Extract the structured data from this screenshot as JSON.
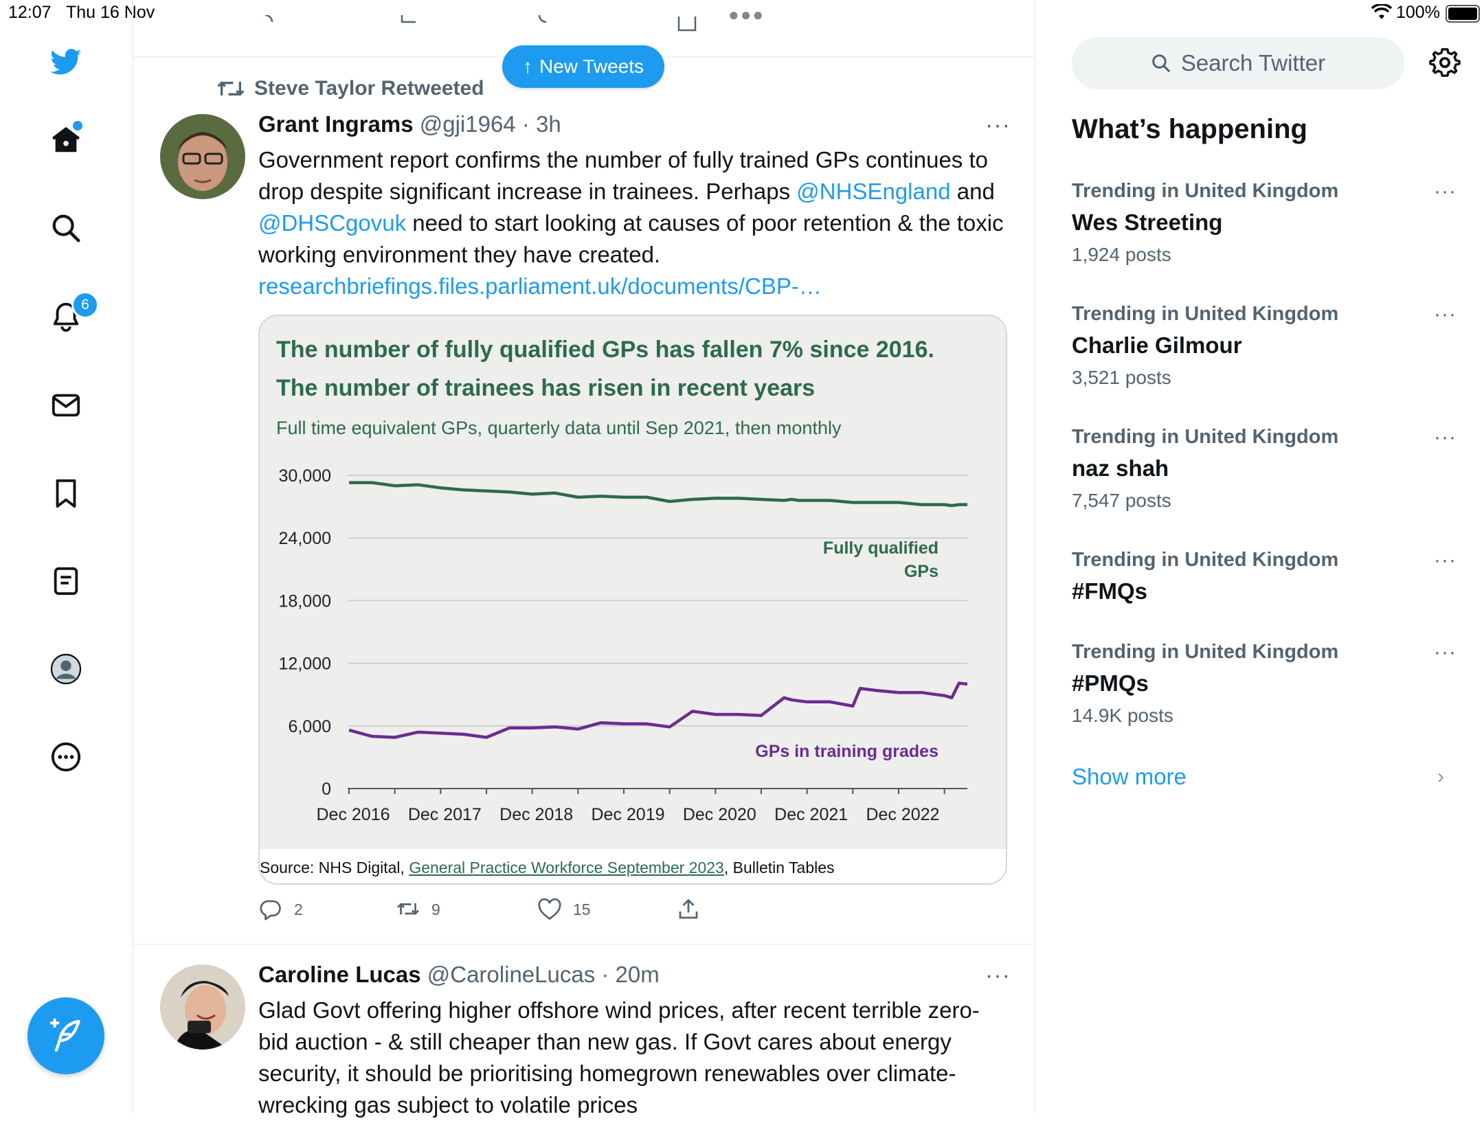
{
  "status_bar": {
    "time": "12:07",
    "date": "Thu 16 Nov",
    "battery": "100%"
  },
  "nav": {
    "notifications_badge": "6"
  },
  "timeline": {
    "new_tweets_label": "New Tweets",
    "retweeted_by": "Steve Taylor Retweeted",
    "tweet1": {
      "name": "Grant Ingrams",
      "handle": "@gji1964 · 3h",
      "text_a": "Government report confirms the number of fully trained GPs continues to drop despite significant increase in trainees.  Perhaps ",
      "mention1": "@NHSEngland",
      "text_b": " and ",
      "mention2": "@DHSCgovuk",
      "text_c": " need to start looking at causes of poor retention & the toxic working environment they have created.",
      "link": "researchbriefings.files.parliament.uk/documents/CBP-…",
      "replies": "2",
      "retweets": "9",
      "likes": "15"
    },
    "tweet2": {
      "name": "Caroline Lucas",
      "handle": "@CarolineLucas · 20m",
      "text": "Glad Govt offering higher offshore wind prices, after recent terrible zero-bid auction - & still cheaper than new gas. If Govt cares about energy security, it should be prioritising homegrown renewables over climate-wrecking gas subject to volatile prices"
    }
  },
  "chart_data": {
    "type": "line",
    "title_line1": "The number of fully qualified GPs has fallen 7% since 2016.",
    "title_line2": "The number of trainees has risen in recent years",
    "subtitle": "Full time equivalent GPs, quarterly data until Sep 2021, then monthly",
    "ylim": [
      0,
      30000
    ],
    "yticks": [
      "30,000",
      "24,000",
      "18,000",
      "12,000",
      "6,000",
      "0"
    ],
    "ytick_values": [
      30000,
      24000,
      18000,
      12000,
      6000,
      0
    ],
    "xlim": [
      2016.92,
      2023.67
    ],
    "xticks": [
      "Dec 2016",
      "Dec 2017",
      "Dec 2018",
      "Dec 2019",
      "Dec 2020",
      "Dec 2021",
      "Dec 2022"
    ],
    "xtick_values": [
      2016.92,
      2017.92,
      2018.92,
      2019.92,
      2020.92,
      2021.92,
      2022.92
    ],
    "series": [
      {
        "name": "Fully qualified GPs",
        "label_line1": "Fully qualified",
        "label_line2": "GPs",
        "color": "#2d6a4f",
        "x": [
          2016.92,
          2017.17,
          2017.42,
          2017.67,
          2017.92,
          2018.17,
          2018.42,
          2018.67,
          2018.92,
          2019.17,
          2019.42,
          2019.67,
          2019.92,
          2020.17,
          2020.42,
          2020.67,
          2020.92,
          2021.17,
          2021.42,
          2021.67,
          2021.75,
          2021.83,
          2021.92,
          2022.17,
          2022.42,
          2022.67,
          2022.92,
          2023.17,
          2023.42,
          2023.5,
          2023.58,
          2023.67
        ],
        "y": [
          29300,
          29300,
          29000,
          29100,
          28800,
          28600,
          28500,
          28400,
          28200,
          28300,
          27900,
          28000,
          27900,
          27900,
          27500,
          27700,
          27800,
          27800,
          27700,
          27600,
          27700,
          27600,
          27600,
          27600,
          27400,
          27400,
          27400,
          27200,
          27200,
          27100,
          27200,
          27200
        ]
      },
      {
        "name": "GPs in training grades",
        "label": "GPs in training grades",
        "color": "#6a2c91",
        "x": [
          2016.92,
          2017.17,
          2017.42,
          2017.67,
          2017.92,
          2018.17,
          2018.42,
          2018.67,
          2018.92,
          2019.17,
          2019.42,
          2019.67,
          2019.92,
          2020.17,
          2020.42,
          2020.67,
          2020.92,
          2021.17,
          2021.42,
          2021.67,
          2021.75,
          2021.83,
          2021.92,
          2022.17,
          2022.42,
          2022.5,
          2022.58,
          2022.67,
          2022.92,
          2023.17,
          2023.25,
          2023.33,
          2023.42,
          2023.5,
          2023.58,
          2023.67
        ],
        "y": [
          5600,
          5000,
          4900,
          5400,
          5300,
          5200,
          4900,
          5800,
          5800,
          5900,
          5700,
          6300,
          6200,
          6200,
          5900,
          7400,
          7100,
          7100,
          7000,
          8700,
          8500,
          8400,
          8300,
          8300,
          7900,
          9600,
          9500,
          9400,
          9200,
          9200,
          9100,
          9000,
          8900,
          8700,
          10100,
          10000
        ]
      }
    ],
    "source_prefix": "Source: NHS Digital, ",
    "source_link": "General Practice Workforce September 2023",
    "source_suffix": ", Bulletin Tables",
    "grid": "horizontal",
    "legend": "inline labels"
  },
  "sidebar": {
    "search_placeholder": "Search Twitter",
    "section_title": "What’s happening",
    "trends": [
      {
        "context": "Trending in United Kingdom",
        "topic": "Wes Streeting",
        "count": "1,924 posts"
      },
      {
        "context": "Trending in United Kingdom",
        "topic": "Charlie Gilmour",
        "count": "3,521 posts"
      },
      {
        "context": "Trending in United Kingdom",
        "topic": "naz shah",
        "count": "7,547 posts"
      },
      {
        "context": "Trending in United Kingdom",
        "topic": "#FMQs",
        "count": ""
      },
      {
        "context": "Trending in United Kingdom",
        "topic": "#PMQs",
        "count": "14.9K posts"
      }
    ],
    "show_more": "Show more"
  }
}
